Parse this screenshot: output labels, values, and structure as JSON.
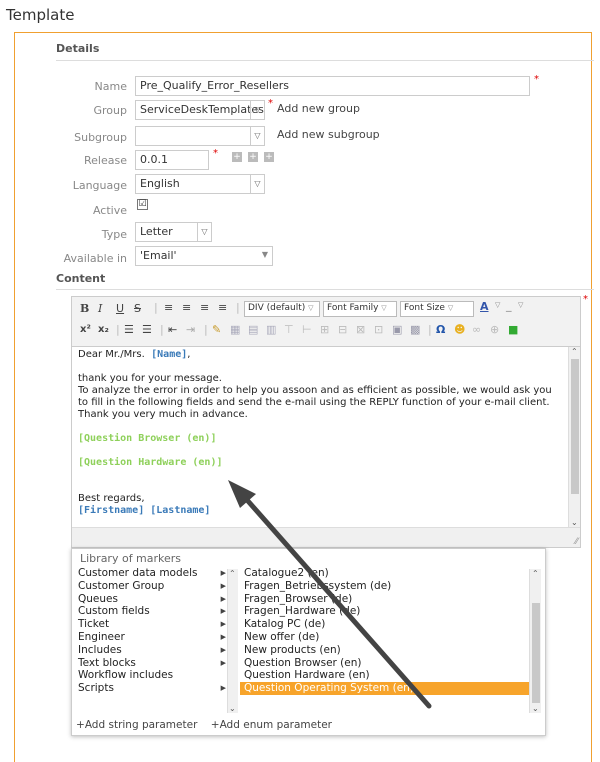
{
  "page_title": "Template",
  "details": {
    "heading": "Details",
    "name_label": "Name",
    "name_value": "Pre_Qualify_Error_Resellers",
    "group_label": "Group",
    "group_value": "ServiceDeskTemplates",
    "add_group": "Add new group",
    "subgroup_label": "Subgroup",
    "subgroup_value": "",
    "add_subgroup": "Add new subgroup",
    "release_label": "Release",
    "release_value": "0.0.1",
    "language_label": "Language",
    "language_value": "English",
    "active_label": "Active",
    "active_checked": "☑",
    "type_label": "Type",
    "type_value": "Letter",
    "available_label": "Available in",
    "available_value": "'Email'"
  },
  "content": {
    "heading": "Content",
    "toolbar": {
      "block_format": "DIV (default)",
      "font_family": "Font Family",
      "font_size": "Font Size"
    },
    "body": {
      "greeting": "Dear Mr./Mrs.",
      "name_marker": "[Name]",
      "greeting_end": ",",
      "para1": "thank you for your message.",
      "para2": "To analyze the error in order to help you assoon and as efficient as possible, we would ask you to fill in the following fields and send the e-mail using the REPLY function of your e-mail client. Thank you very much in advance.",
      "marker_browser": "[Question Browser (en)]",
      "marker_hardware": "[Question Hardware (en)]",
      "regards": "Best regards,",
      "sign_marker": "[Firstname] [Lastname]"
    }
  },
  "library": {
    "title": "Library of markers",
    "categories": [
      "Customer data models",
      "Customer Group",
      "Queues",
      "Custom fields",
      "Ticket",
      "Engineer",
      "Includes",
      "Text blocks",
      "Workflow includes",
      "Scripts"
    ],
    "items": [
      "Catalogue2 (en)",
      "Fragen_Betriebssystem (de)",
      "Fragen_Browser (de)",
      "Fragen_Hardware (de)",
      "Katalog PC (de)",
      "New offer (de)",
      "New products (en)",
      "Question Browser (en)",
      "Question Hardware (en)",
      "Question Operating System (en)"
    ],
    "selected_item": "Question Operating System (en)",
    "add_string": "Add string parameter",
    "add_enum": "Add enum parameter"
  },
  "colors": {
    "accent": "#f7a42b",
    "panel_border": "#f0a030",
    "marker_blue": "#3a7ab8",
    "marker_green": "#8ed05a"
  }
}
